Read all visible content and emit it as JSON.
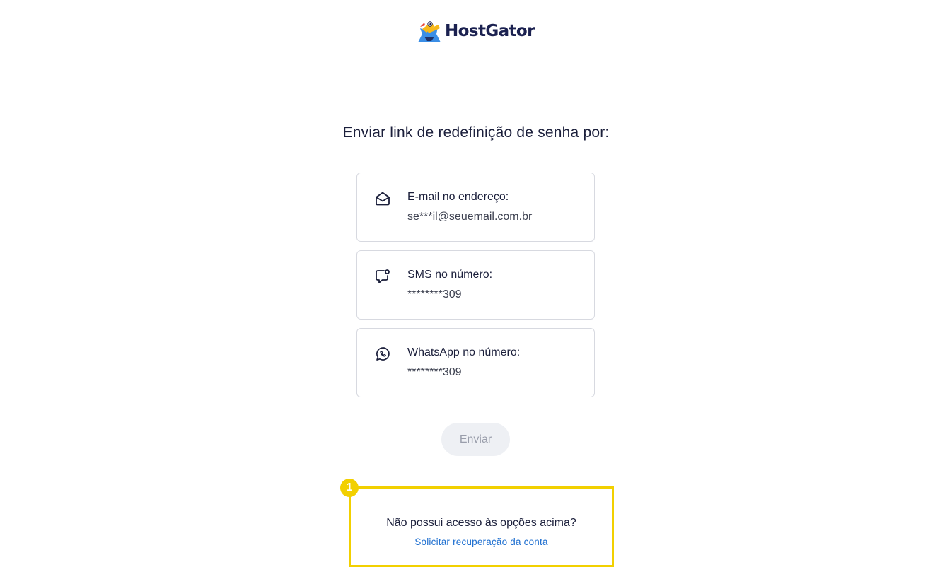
{
  "brand": {
    "name": "HostGator",
    "text_color": "#1b2150",
    "mascot_colors": [
      "#f6b81a",
      "#3a8ee6",
      "#e63b2e",
      "#1b2150"
    ]
  },
  "heading": "Enviar link de redefinição de senha por:",
  "options": [
    {
      "icon": "envelope-open-icon",
      "title": "E-mail no endereço:",
      "value": "se***il@seuemail.com.br"
    },
    {
      "icon": "sms-chat-icon",
      "title": "SMS no número:",
      "value": "********309"
    },
    {
      "icon": "whatsapp-icon",
      "title": "WhatsApp no número:",
      "value": "********309"
    }
  ],
  "send_button": {
    "label": "Enviar",
    "disabled": true
  },
  "annotation": {
    "marker": "1",
    "color": "#f2d000"
  },
  "no_access_text": "Não possui acesso às opções acima?",
  "recover_link": "Solicitar recuperação da conta",
  "colors": {
    "text": "#1b1f3b",
    "link": "#1e6fd0",
    "border": "#d7d9e0",
    "button_bg": "#eef0f4",
    "button_text": "#9a9eab"
  }
}
